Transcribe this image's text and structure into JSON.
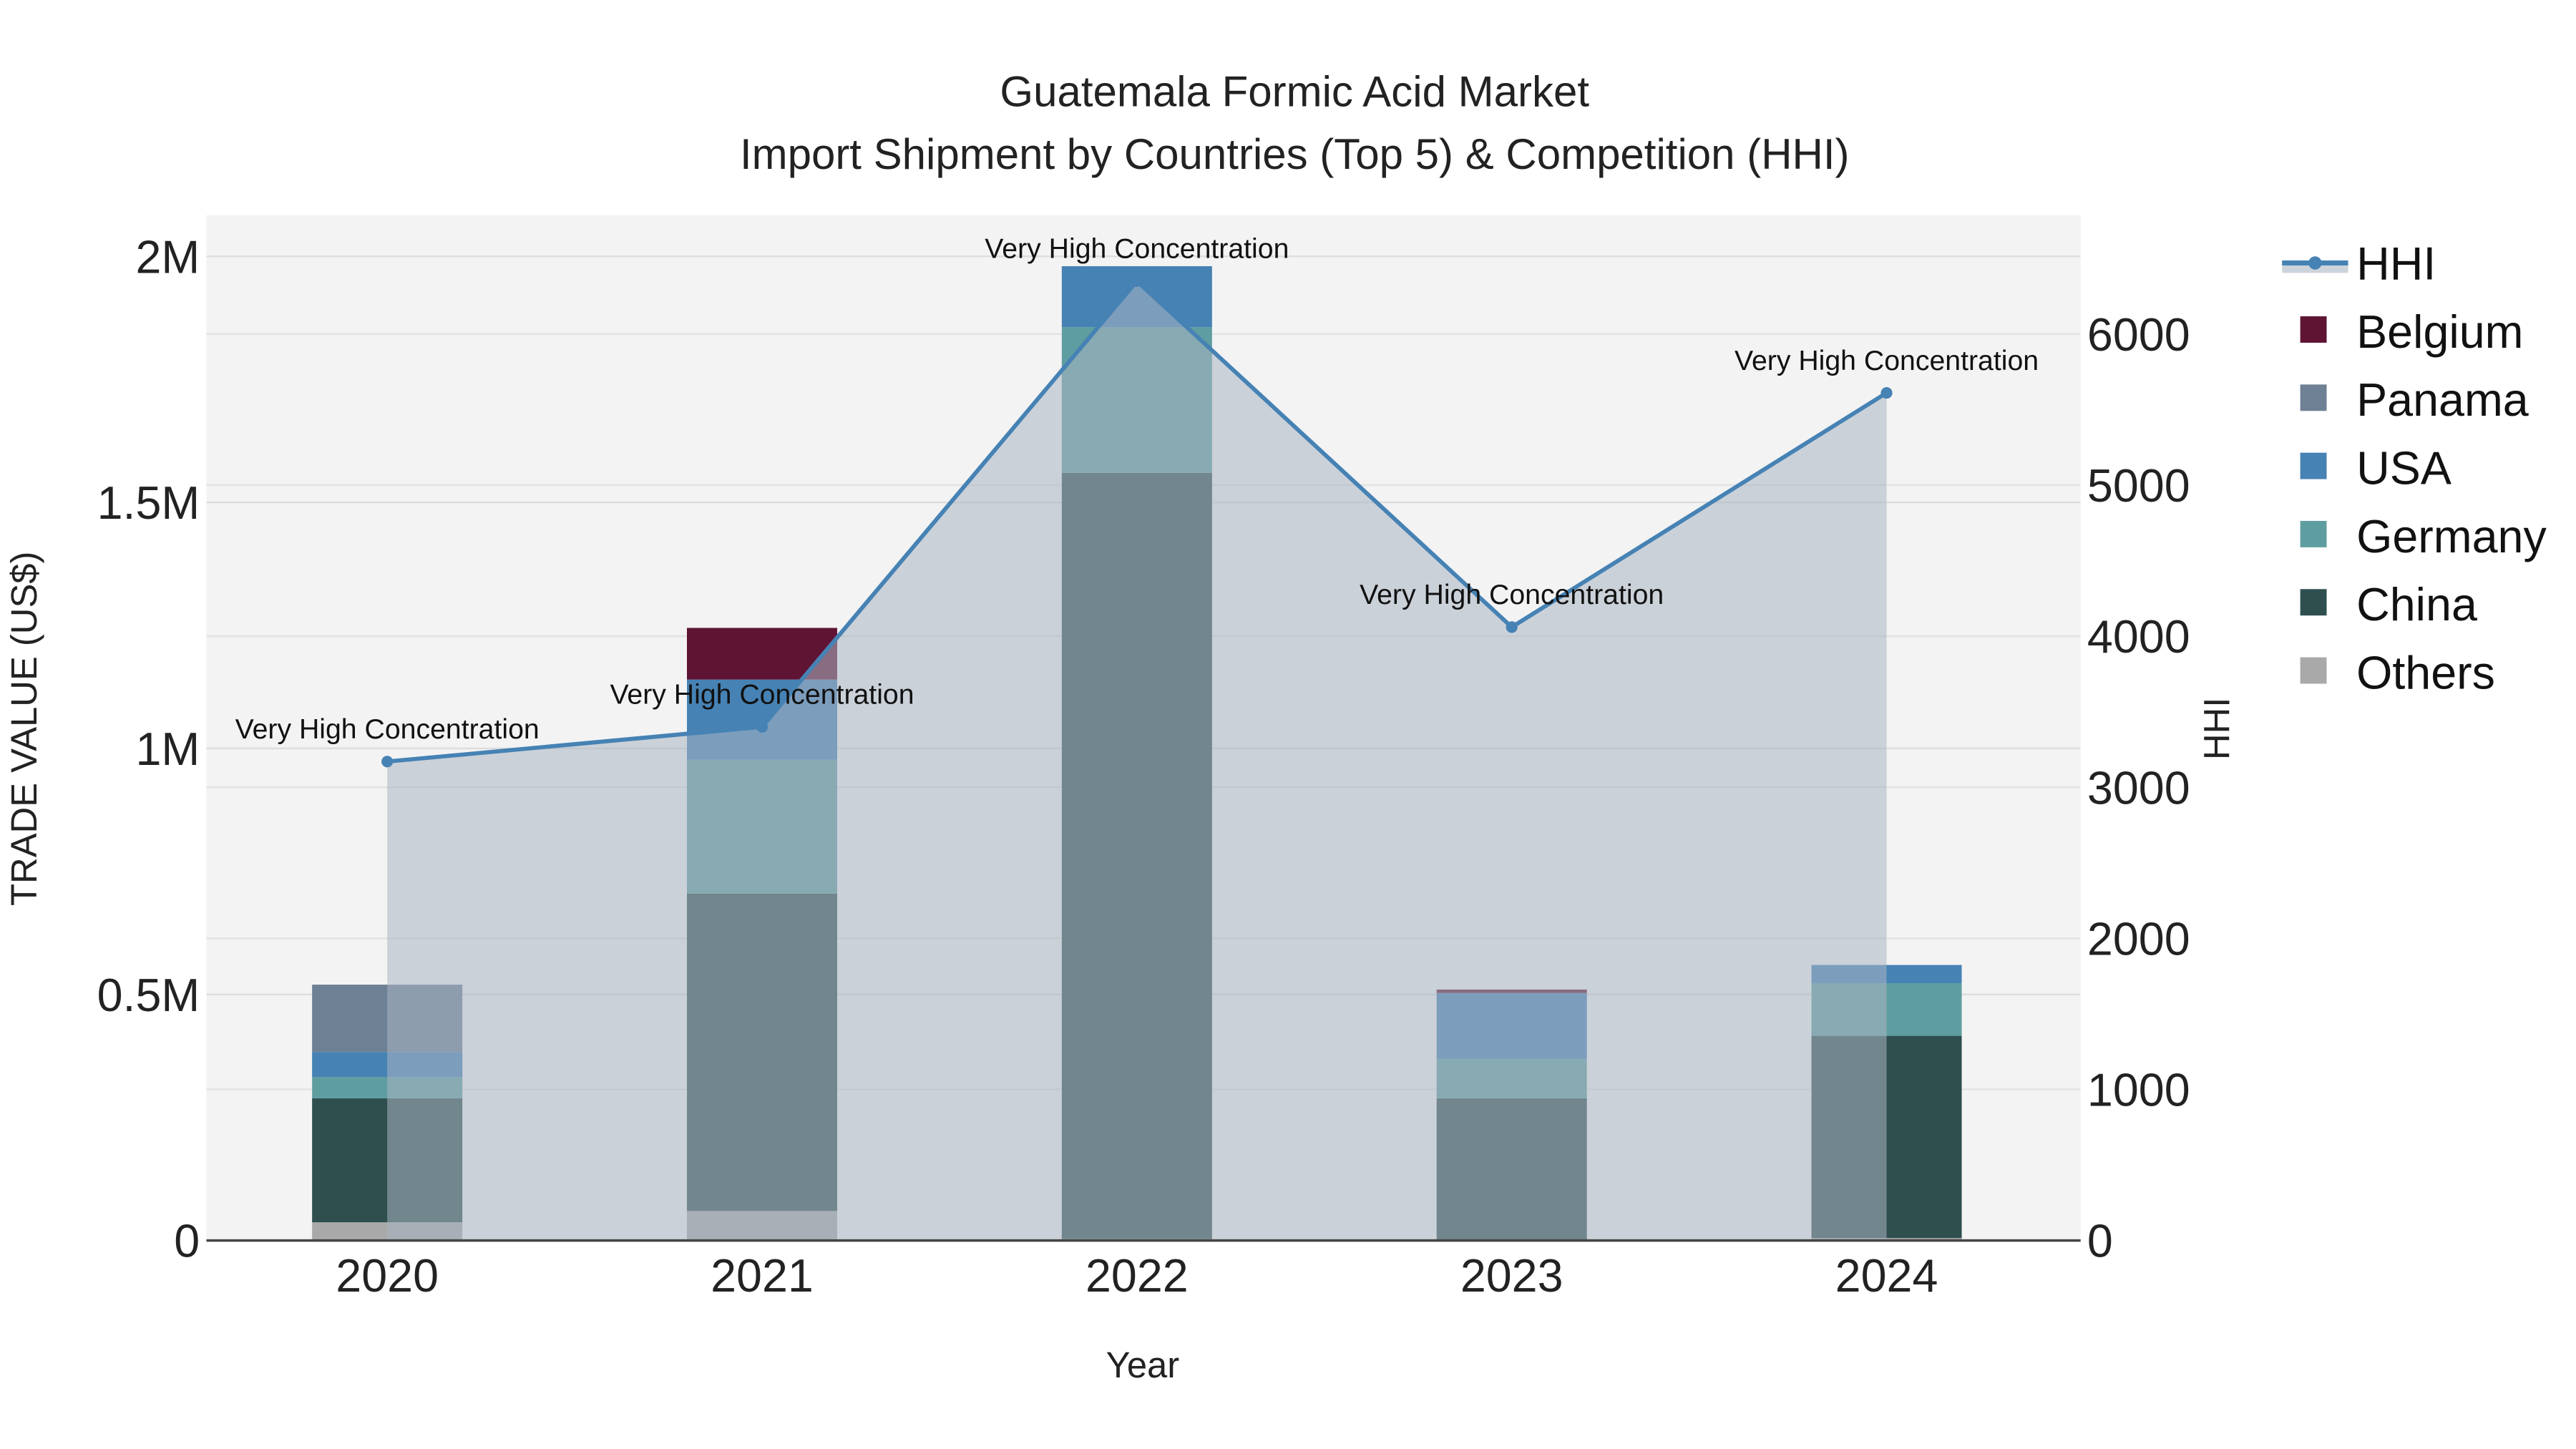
{
  "chart_data": {
    "type": "bar",
    "title": "Guatemala Formic Acid Market",
    "subtitle": "Import Shipment by Countries (Top 5) & Competition (HHI)",
    "xlabel": "Year",
    "ylabel": "TRADE VALUE (US$)",
    "y2label": "HHI",
    "categories": [
      "2020",
      "2021",
      "2022",
      "2023",
      "2024"
    ],
    "ylim": [
      0,
      2080000
    ],
    "y2lim": [
      0,
      6800
    ],
    "yticks": [
      {
        "v": 0,
        "label": "0"
      },
      {
        "v": 500000,
        "label": "0.5M"
      },
      {
        "v": 1000000,
        "label": "1M"
      },
      {
        "v": 1500000,
        "label": "1.5M"
      },
      {
        "v": 2000000,
        "label": "2M"
      }
    ],
    "y2ticks": [
      {
        "v": 0,
        "label": "0"
      },
      {
        "v": 1000,
        "label": "1000"
      },
      {
        "v": 2000,
        "label": "2000"
      },
      {
        "v": 3000,
        "label": "3000"
      },
      {
        "v": 4000,
        "label": "4000"
      },
      {
        "v": 5000,
        "label": "5000"
      },
      {
        "v": 6000,
        "label": "6000"
      }
    ],
    "series": [
      {
        "name": "Others",
        "color": "#a9a9a9",
        "values": [
          37000,
          60000,
          3000,
          2000,
          5000
        ]
      },
      {
        "name": "China",
        "color": "#2f4f4f",
        "values": [
          252000,
          645000,
          1557000,
          287000,
          411000
        ]
      },
      {
        "name": "Germany",
        "color": "#5f9ea0",
        "values": [
          43000,
          272000,
          296000,
          80000,
          107000
        ]
      },
      {
        "name": "USA",
        "color": "#4682b4",
        "values": [
          51000,
          163000,
          124000,
          134000,
          37000
        ]
      },
      {
        "name": "Panama",
        "color": "#6e8094",
        "values": [
          137000,
          0,
          0,
          0,
          0
        ]
      },
      {
        "name": "Belgium",
        "color": "#5f1434",
        "values": [
          0,
          105000,
          0,
          7000,
          0
        ]
      }
    ],
    "legend_order": [
      "HHI",
      "Belgium",
      "Panama",
      "USA",
      "Germany",
      "China",
      "Others"
    ],
    "hhi": {
      "name": "HHI",
      "color": "#4682b4",
      "values": [
        3170,
        3400,
        6350,
        4060,
        5610
      ]
    },
    "annotations": [
      "Very High Concentration",
      "Very High Concentration",
      "Very High Concentration",
      "Very High Concentration",
      "Very High Concentration"
    ],
    "legend_position": "right"
  }
}
